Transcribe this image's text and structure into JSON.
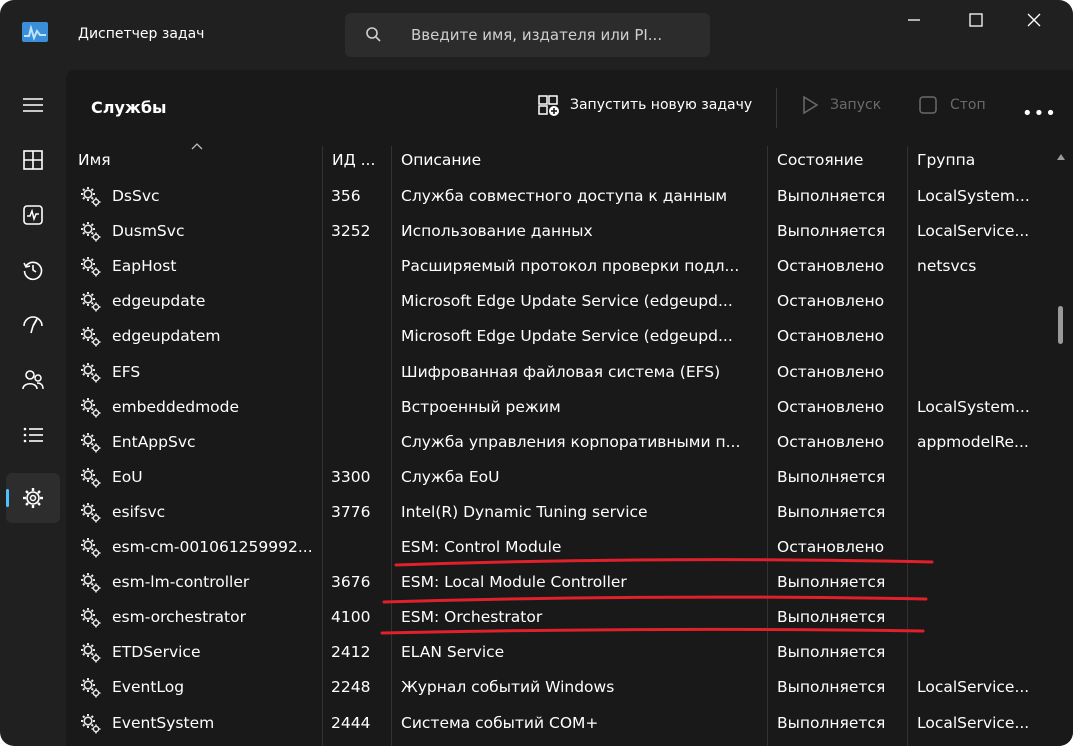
{
  "window": {
    "title": "Диспетчер задач",
    "search_placeholder": "Введите имя, издателя или PI..."
  },
  "sidebar": {
    "items": [
      {
        "icon": "hamburger-menu-icon",
        "active": false
      },
      {
        "icon": "processes-icon",
        "active": false
      },
      {
        "icon": "performance-icon",
        "active": false
      },
      {
        "icon": "app-history-icon",
        "active": false
      },
      {
        "icon": "startup-apps-icon",
        "active": false
      },
      {
        "icon": "users-icon",
        "active": false
      },
      {
        "icon": "details-icon",
        "active": false
      },
      {
        "icon": "services-icon",
        "active": true
      }
    ]
  },
  "page": {
    "title": "Службы",
    "actions": {
      "new_task": "Запустить новую задачу",
      "start": "Запуск",
      "stop": "Стоп",
      "more": "•••"
    }
  },
  "table": {
    "headers": {
      "name": "Имя",
      "pid": "ИД ...",
      "description": "Описание",
      "status": "Состояние",
      "group": "Группа"
    },
    "rows": [
      {
        "name": "DsSvc",
        "pid": "356",
        "description": "Служба совместного доступа к данным",
        "status": "Выполняется",
        "group": "LocalSystem..."
      },
      {
        "name": "DusmSvc",
        "pid": "3252",
        "description": "Использование данных",
        "status": "Выполняется",
        "group": "LocalService..."
      },
      {
        "name": "EapHost",
        "pid": "",
        "description": "Расширяемый протокол проверки подл...",
        "status": "Остановлено",
        "group": "netsvcs"
      },
      {
        "name": "edgeupdate",
        "pid": "",
        "description": "Microsoft Edge Update Service (edgeupd...",
        "status": "Остановлено",
        "group": ""
      },
      {
        "name": "edgeupdatem",
        "pid": "",
        "description": "Microsoft Edge Update Service (edgeupd...",
        "status": "Остановлено",
        "group": ""
      },
      {
        "name": "EFS",
        "pid": "",
        "description": "Шифрованная файловая система (EFS)",
        "status": "Остановлено",
        "group": ""
      },
      {
        "name": "embeddedmode",
        "pid": "",
        "description": "Встроенный режим",
        "status": "Остановлено",
        "group": "LocalSystem..."
      },
      {
        "name": "EntAppSvc",
        "pid": "",
        "description": "Служба управления корпоративными п...",
        "status": "Остановлено",
        "group": "appmodelRe..."
      },
      {
        "name": "EoU",
        "pid": "3300",
        "description": "Служба EoU",
        "status": "Выполняется",
        "group": ""
      },
      {
        "name": "esifsvc",
        "pid": "3776",
        "description": "Intel(R) Dynamic Tuning service",
        "status": "Выполняется",
        "group": ""
      },
      {
        "name": "esm-cm-001061259992...",
        "pid": "",
        "description": "ESM: Control Module",
        "status": "Остановлено",
        "group": ""
      },
      {
        "name": "esm-lm-controller",
        "pid": "3676",
        "description": "ESM: Local Module Controller",
        "status": "Выполняется",
        "group": ""
      },
      {
        "name": "esm-orchestrator",
        "pid": "4100",
        "description": "ESM: Orchestrator",
        "status": "Выполняется",
        "group": ""
      },
      {
        "name": "ETDService",
        "pid": "2412",
        "description": "ELAN Service",
        "status": "Выполняется",
        "group": ""
      },
      {
        "name": "EventLog",
        "pid": "2248",
        "description": "Журнал событий Windows",
        "status": "Выполняется",
        "group": "LocalService..."
      },
      {
        "name": "EventSystem",
        "pid": "2444",
        "description": "Система событий COM+",
        "status": "Выполняется",
        "group": "LocalService..."
      }
    ]
  },
  "annotations": {
    "underline_color": "#e0202a",
    "underlined_rows": [
      10,
      11,
      12
    ]
  },
  "colors": {
    "window_bg": "#202020",
    "content_bg": "#191919",
    "accent": "#4cc2ff"
  }
}
